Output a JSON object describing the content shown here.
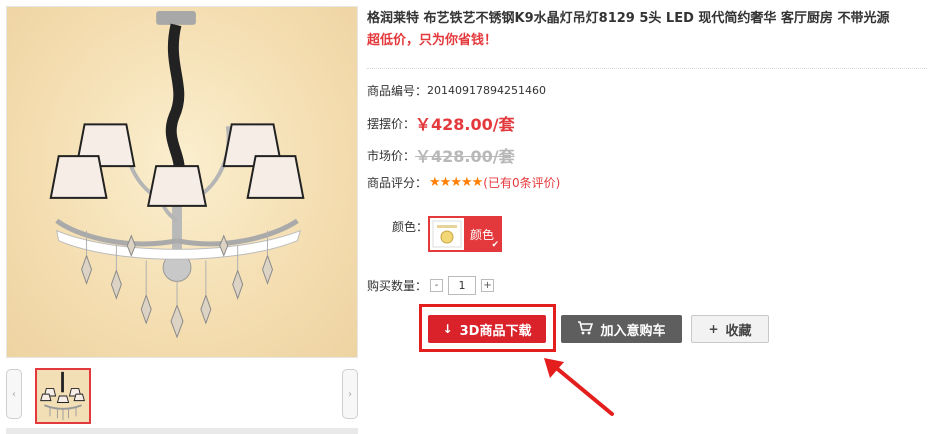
{
  "product": {
    "title": "格润莱特 布艺铁艺不锈钢K9水晶灯吊灯8129 5头 LED 现代简约奢华 客厅厨房 不带光源",
    "slogan": "超低价，只为你省钱！"
  },
  "details": {
    "sku_label": "商品编号：",
    "sku_value": "20140917894251460",
    "price_label": "摆摆价：",
    "price_value": "￥428.00/套",
    "market_label": "市场价：",
    "market_value": "￥428.00/套",
    "rating_label": "商品评分：",
    "rating_stars": "★★★★★",
    "rating_note": "(已有0条评价)"
  },
  "options": {
    "color_label": "颜色：",
    "color_value": "颜色",
    "qty_label": "购买数量：",
    "qty_minus": "-",
    "qty_value": "1",
    "qty_plus": "+"
  },
  "actions": {
    "download_icon": "↓",
    "download_label": "3D商品下载",
    "cart_label": "加入意购车",
    "favorite_icon": "+",
    "favorite_label": "收藏"
  },
  "gallery": {
    "prev_icon": "‹",
    "next_icon": "›"
  },
  "colors": {
    "accent": "#e4393c",
    "download_button": "#d9222a",
    "cart_button": "#5e5e5e",
    "highlight": "#e41d1d"
  }
}
